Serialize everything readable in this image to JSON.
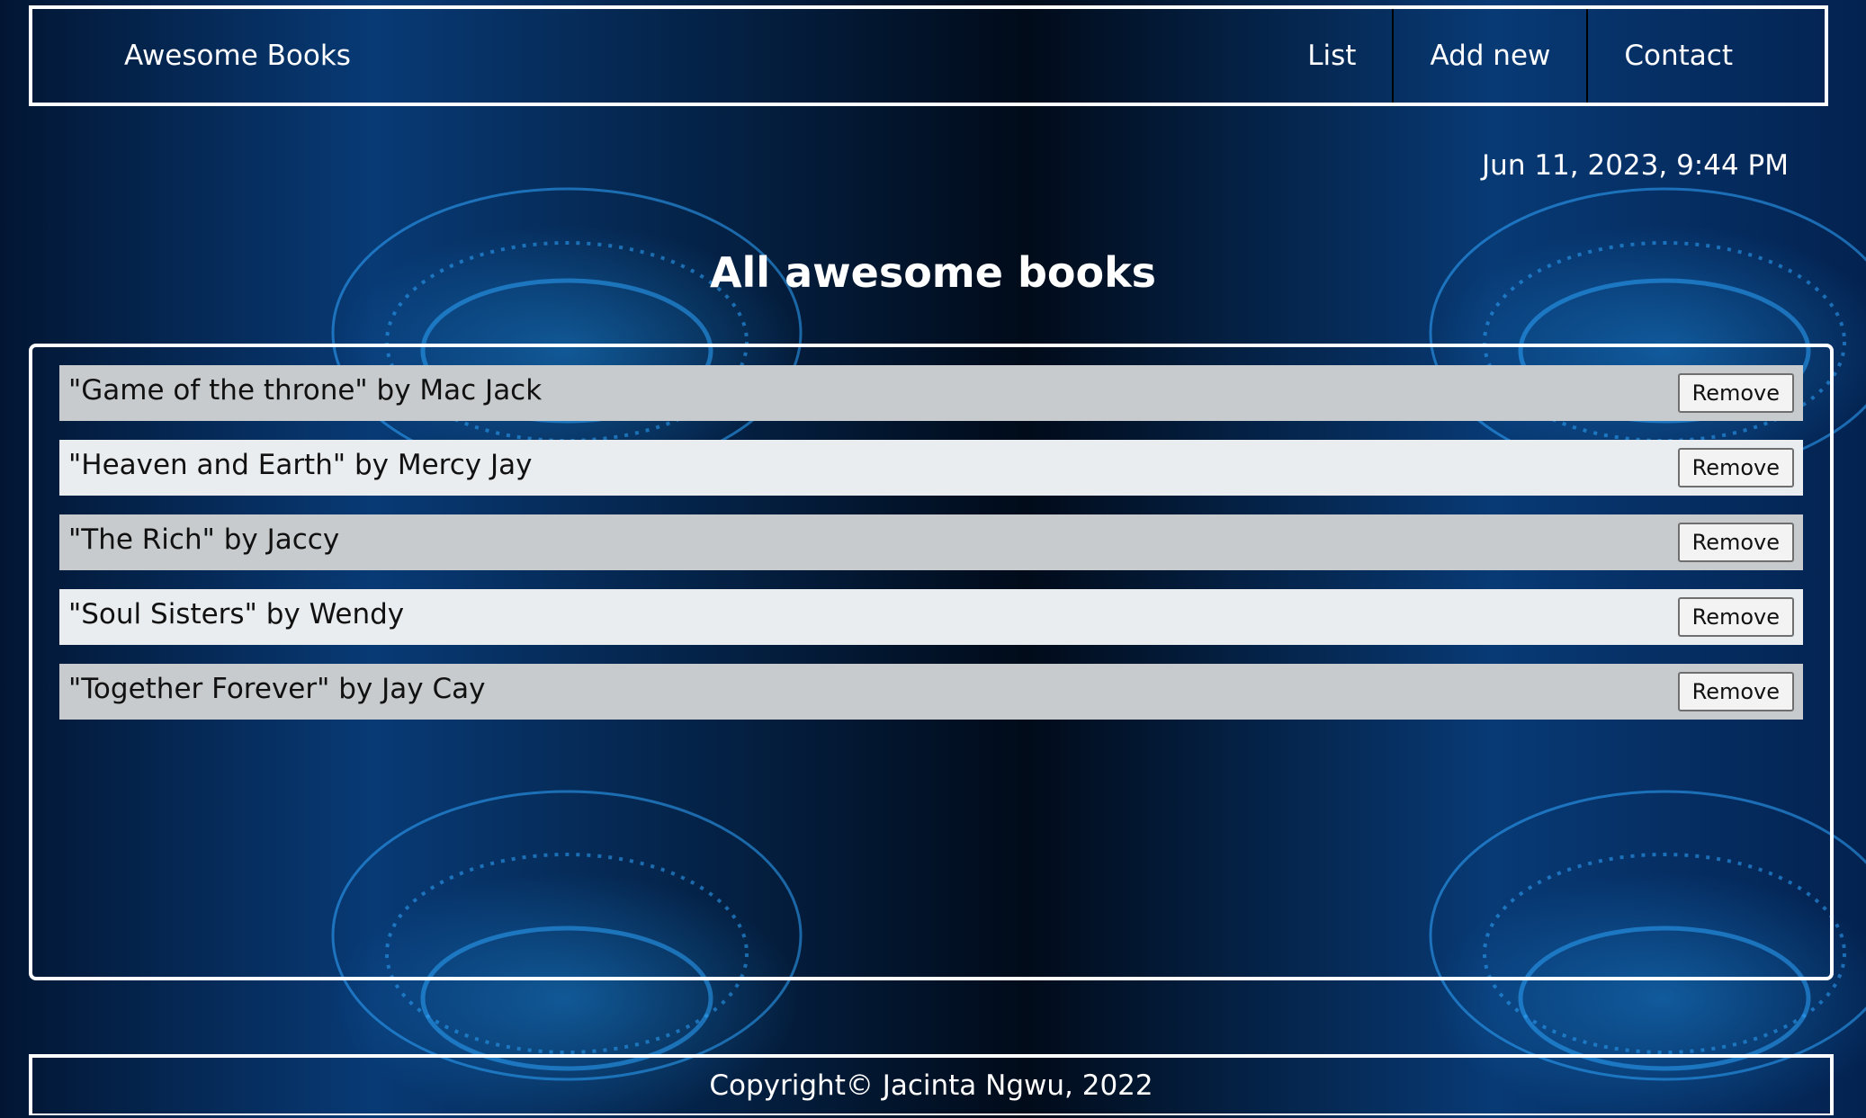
{
  "header": {
    "brand": "Awesome Books",
    "nav": [
      {
        "label": "List"
      },
      {
        "label": "Add new"
      },
      {
        "label": "Contact"
      }
    ]
  },
  "datetime": "Jun 11, 2023, 9:44 PM",
  "main": {
    "title": "All awesome books",
    "books": [
      {
        "text": "\"Game of the throne\" by Mac Jack",
        "button": "Remove"
      },
      {
        "text": "\"Heaven and Earth\" by Mercy Jay",
        "button": "Remove"
      },
      {
        "text": "\"The Rich\" by Jaccy",
        "button": "Remove"
      },
      {
        "text": "\"Soul Sisters\" by Wendy",
        "button": "Remove"
      },
      {
        "text": "\"Together Forever\" by Jay Cay",
        "button": "Remove"
      }
    ]
  },
  "footer": {
    "copyright": "Copyright© Jacinta Ngwu, 2022"
  },
  "colors": {
    "background": "#03142e",
    "row_odd": "#c7cbcd",
    "row_even": "#e9edef",
    "border": "#ffffff",
    "glow": "#1e8fe0"
  }
}
